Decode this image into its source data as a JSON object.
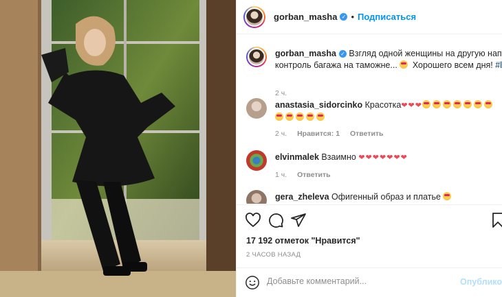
{
  "header": {
    "username": "gorban_masha",
    "separator": "•",
    "follow_label": "Подписаться"
  },
  "caption": {
    "username": "gorban_masha",
    "text_line1": "Взгляд одной женщины на другую напомина",
    "text_line2": "контроль багажа на таможне...",
    "text_tail": "Хорошего всем дня!",
    "hashtag": "#love",
    "time": "2 ч."
  },
  "comments": [
    {
      "username": "anastasia_sidorcinko",
      "text": "Красотка",
      "time": "2 ч.",
      "likes": "Нравится: 1",
      "reply": "Ответить"
    },
    {
      "username": "elvinmalek",
      "text": "Взаимно",
      "hearts": "❤❤❤❤❤❤❤",
      "time": "1 ч.",
      "reply": "Ответить"
    },
    {
      "username": "gera_zheleva",
      "text": "Офигенный образ и платье"
    }
  ],
  "likes_text": "17 192 отметок \"Нравится\"",
  "posted_time": "2 ЧАСОВ НАЗАД",
  "add_comment": {
    "placeholder": "Добавьте комментарий...",
    "publish_label": "Опубликов"
  },
  "colors": {
    "accent": "#0095f6",
    "heart": "#ed4956",
    "muted": "#8e8e8e"
  }
}
